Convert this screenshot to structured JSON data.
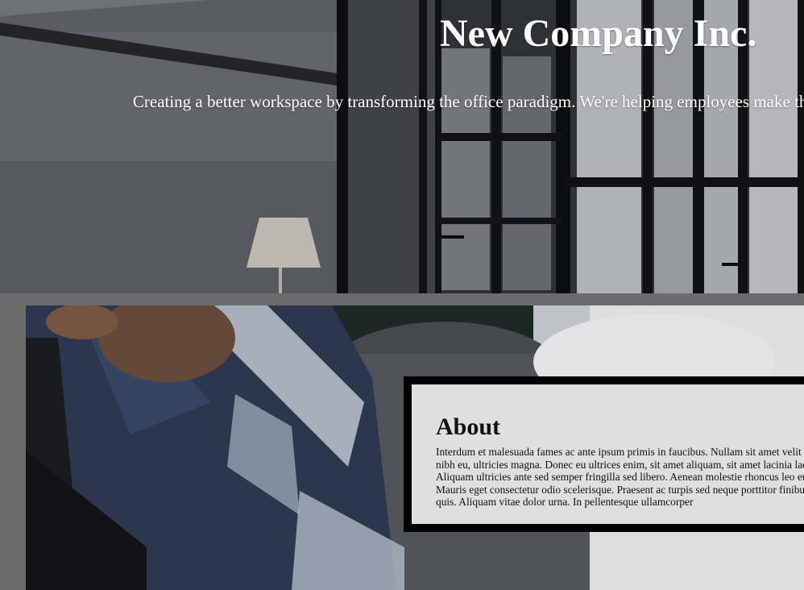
{
  "hero": {
    "title": "New Company Inc.",
    "tagline": "Creating a better workspace by transforming the office paradigm. We're helping employees make the most of their workspace management."
  },
  "about": {
    "heading": "About",
    "body": "Interdum et malesuada fames ac ante ipsum primis in faucibus. Nullam sit amet velit congue, finibus nibh eu, ultricies magna. Donec eu ultrices enim, sit amet aliquam, sit amet lacinia lacus commodo. Aliquam ultricies ante sed semper fringilla sed libero. Aenean molestie rhoncus leo eu imperdiet. Mauris eget consectetur odio scelerisque. Praesent ac turpis sed neque porttitor finibus eu tellus rhoncus quis. Aliquam vitae dolor urna. In pellentesque ullamcorper"
  },
  "colors": {
    "page_background": "#6b6b6b",
    "hero_text": "#ffffff",
    "card_border": "#000000",
    "card_fill": "#f0f0f0"
  }
}
